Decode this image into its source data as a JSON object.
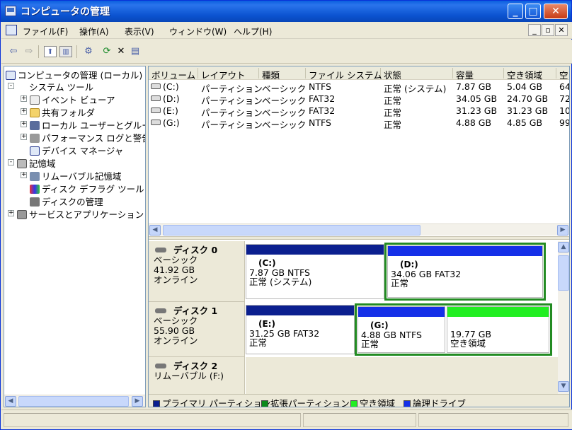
{
  "window": {
    "title": "コンピュータの管理"
  },
  "menu": {
    "items": [
      "ファイル(F)",
      "操作(A)",
      "表示(V)",
      "ウィンドウ(W)",
      "ヘルプ(H)"
    ]
  },
  "tree": {
    "root": "コンピュータの管理 (ローカル)",
    "system_tools": "システム ツール",
    "event_viewer": "イベント ビューア",
    "shared_folders": "共有フォルダ",
    "local_users": "ローカル ユーザーとグルー",
    "perf_logs": "パフォーマンス ログと警告",
    "device_manager": "デバイス マネージャ",
    "storage": "記憶域",
    "removable_storage": "リムーバブル記憶域",
    "defrag": "ディスク デフラグ ツール",
    "disk_mgmt": "ディスクの管理",
    "services_apps": "サービスとアプリケーション"
  },
  "volumes": {
    "columns": [
      "ボリューム",
      "レイアウト",
      "種類",
      "ファイル システム",
      "状態",
      "容量",
      "空き領域",
      "空"
    ],
    "rows": [
      {
        "volume": "(C:)",
        "layout": "パーティション",
        "type": "ベーシック",
        "fs": "NTFS",
        "status": "正常 (システム)",
        "capacity": "7.87 GB",
        "free": "5.04 GB",
        "pct": "64"
      },
      {
        "volume": "(D:)",
        "layout": "パーティション",
        "type": "ベーシック",
        "fs": "FAT32",
        "status": "正常",
        "capacity": "34.05 GB",
        "free": "24.70 GB",
        "pct": "72"
      },
      {
        "volume": "(E:)",
        "layout": "パーティション",
        "type": "ベーシック",
        "fs": "FAT32",
        "status": "正常",
        "capacity": "31.23 GB",
        "free": "31.23 GB",
        "pct": "10"
      },
      {
        "volume": "(G:)",
        "layout": "パーティション",
        "type": "ベーシック",
        "fs": "NTFS",
        "status": "正常",
        "capacity": "4.88 GB",
        "free": "4.85 GB",
        "pct": "99"
      }
    ]
  },
  "disks": {
    "disk0": {
      "name": "ディスク 0",
      "type": "ベーシック",
      "size": "41.92 GB",
      "state": "オンライン",
      "p1": {
        "name": "(C:)",
        "line1": "7.87 GB NTFS",
        "line2": "正常 (システム)"
      },
      "p2": {
        "name": "(D:)",
        "line1": "34.06 GB FAT32",
        "line2": "正常"
      }
    },
    "disk1": {
      "name": "ディスク 1",
      "type": "ベーシック",
      "size": "55.90 GB",
      "state": "オンライン",
      "p1": {
        "name": "(E:)",
        "line1": "31.25 GB FAT32",
        "line2": "正常"
      },
      "p2": {
        "name": "(G:)",
        "line1": "4.88 GB NTFS",
        "line2": "正常"
      },
      "p3": {
        "line1": "19.77 GB",
        "line2": "空き領域"
      }
    },
    "disk2": {
      "name": "ディスク 2",
      "type": "リムーバブル (F:)"
    }
  },
  "legend": {
    "primary": "プライマリ パーティション",
    "extended": "拡張パーティション",
    "free": "空き領域",
    "logical": "論理ドライブ"
  },
  "colors": {
    "primary": "#0b1f8f",
    "extended": "#0b8a1a",
    "free": "#22ee22",
    "logical": "#1530e8",
    "selection": "#228b22"
  }
}
